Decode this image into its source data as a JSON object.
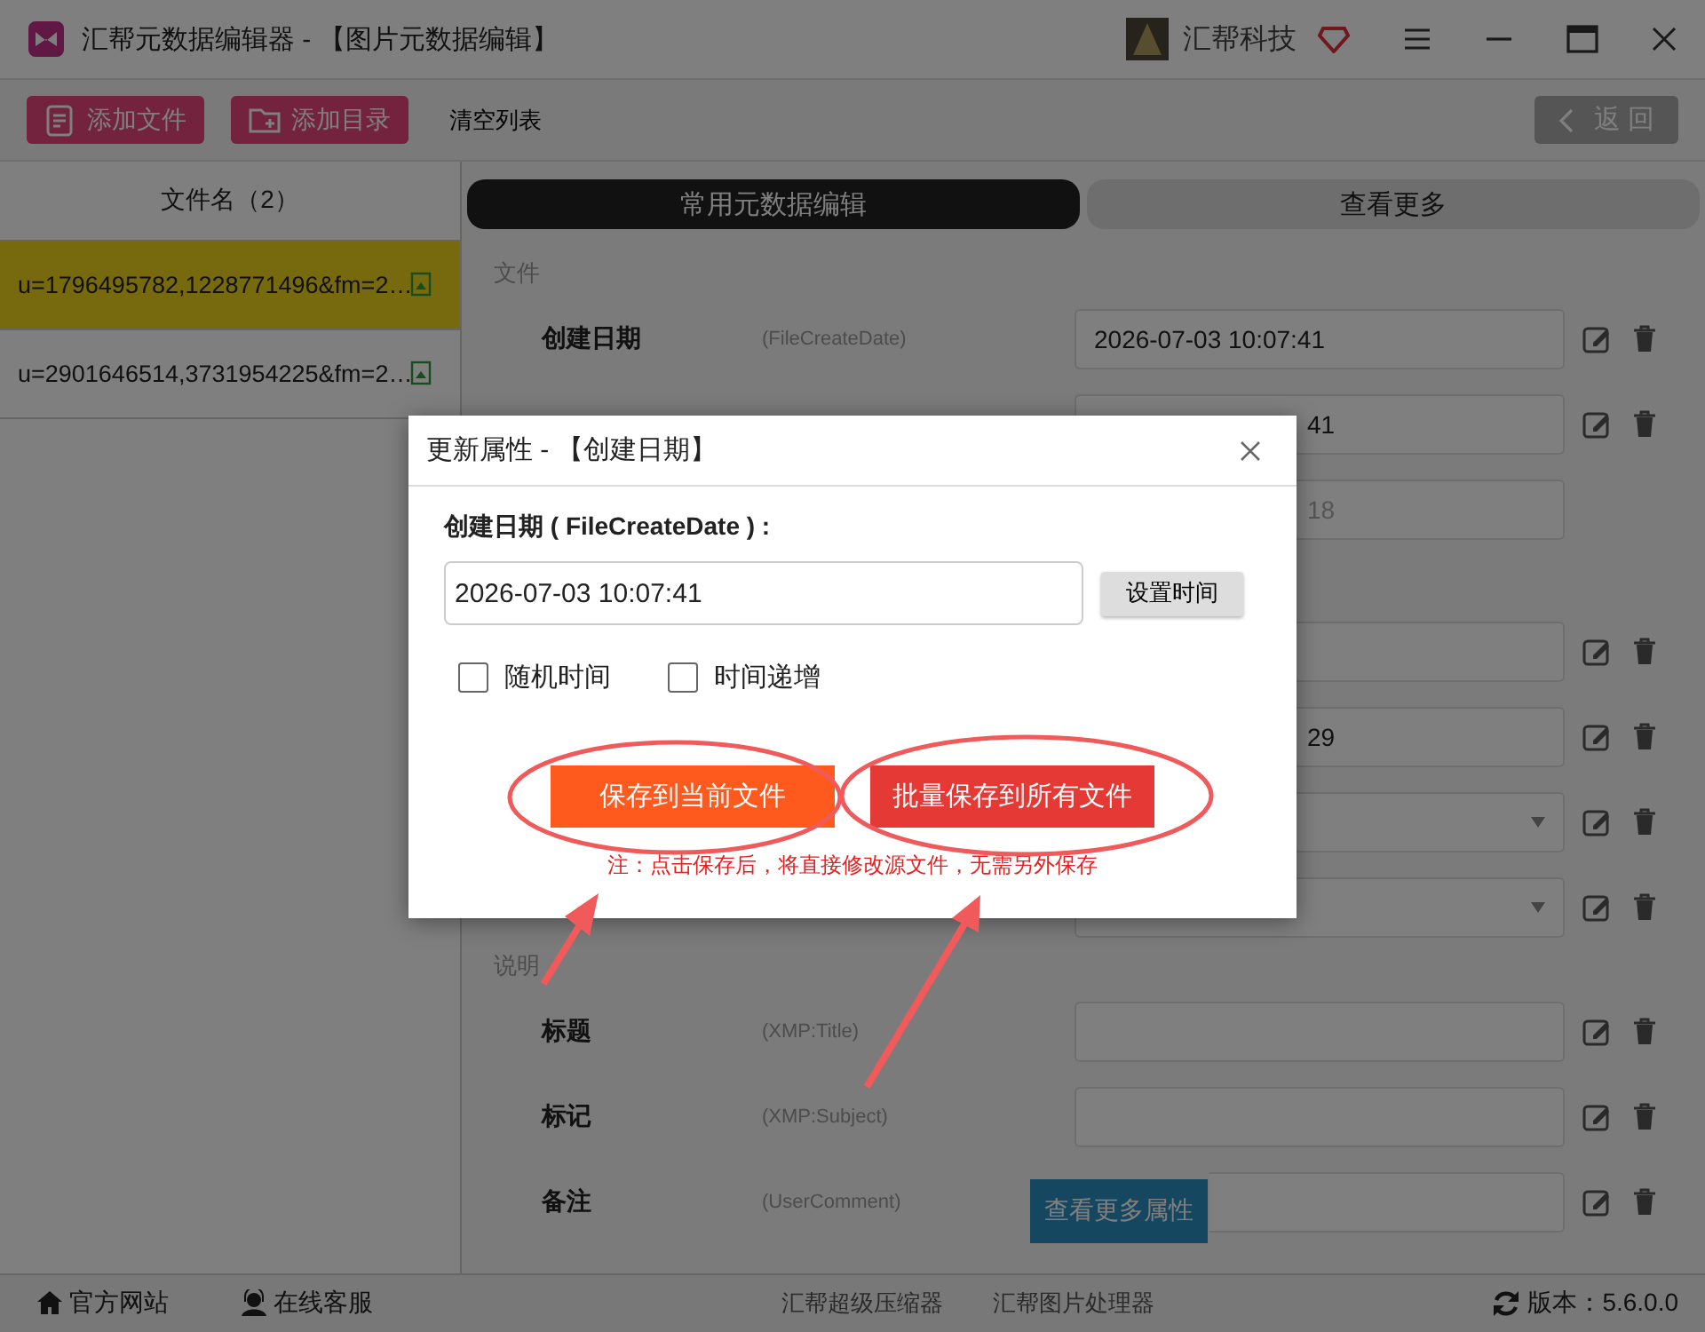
{
  "window": {
    "title": "汇帮元数据编辑器 - 【图片元数据编辑】",
    "brand": "汇帮科技"
  },
  "toolbar": {
    "buttons": [
      {
        "label": "添加文件",
        "kind": "file"
      },
      {
        "label": "添加目录",
        "kind": "folder"
      }
    ],
    "clear": "清空列表",
    "back": "返 回"
  },
  "file_list": {
    "header": "文件名（2）",
    "items": [
      {
        "name": "u=1796495782,1228771496&fm=2…",
        "selected": true
      },
      {
        "name": "u=2901646514,3731954225&fm=2…",
        "selected": false
      }
    ]
  },
  "tabs": [
    {
      "label": "常用元数据编辑",
      "selected": true
    },
    {
      "label": "查看更多",
      "selected": false
    }
  ],
  "editor": [
    {
      "kind": "section",
      "label": "文件"
    },
    {
      "kind": "field",
      "label": "创建日期",
      "tag": "(FileCreateDate)",
      "value": "2026-07-03 10:07:41",
      "editable": true
    },
    {
      "kind": "field",
      "value": "41",
      "clipped": true,
      "editable": true
    },
    {
      "kind": "field",
      "value": "18",
      "clipped": true,
      "editable": false
    },
    {
      "kind": "field",
      "editable": true
    },
    {
      "kind": "field",
      "value": "29",
      "clipped": true,
      "editable": true
    },
    {
      "kind": "select",
      "editable": true
    },
    {
      "kind": "select",
      "editable": true
    },
    {
      "kind": "section",
      "label": "说明"
    },
    {
      "kind": "field",
      "label": "标题",
      "tag": "(XMP:Title)",
      "editable": true
    },
    {
      "kind": "field",
      "label": "标记",
      "tag": "(XMP:Subject)",
      "editable": true
    },
    {
      "kind": "field",
      "label": "备注",
      "tag": "(UserComment)",
      "editable": true
    }
  ],
  "more_button": "查看更多属性",
  "footer": {
    "links": [
      {
        "label": "官方网站",
        "kind": "home"
      },
      {
        "label": "在线客服",
        "kind": "support"
      }
    ],
    "apps": [
      "汇帮超级压缩器",
      "汇帮图片处理器"
    ],
    "version": "版本：5.6.0.0"
  },
  "dialog": {
    "title": "更新属性 - 【创建日期】",
    "field_label": "创建日期 ( FileCreateDate ) :",
    "value": "2026-07-03 10:07:41",
    "set_time": "设置时间",
    "options": [
      {
        "label": "随机时间",
        "checked": false
      },
      {
        "label": "时间递增",
        "checked": false
      }
    ],
    "buttons": [
      {
        "label": "保存到当前文件",
        "kind": "current"
      },
      {
        "label": "批量保存到所有文件",
        "kind": "all"
      }
    ],
    "note": "注：点击保存后，将直接修改源文件，无需另外保存"
  }
}
